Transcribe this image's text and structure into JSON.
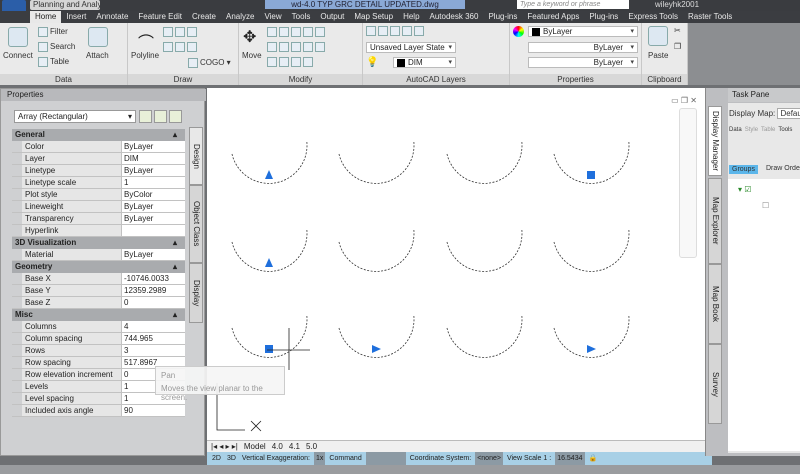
{
  "titlebar": {
    "app_badge": "MAP",
    "quick_access": "Planning and Analysis...",
    "document_title": "wd-4.0 TYP GRC DETAIL UPDATED.dwg",
    "search_placeholder": "Type a keyword or phrase",
    "user": "wileyhk2001"
  },
  "tabs": [
    "Home",
    "Insert",
    "Annotate",
    "Feature Edit",
    "Create",
    "Analyze",
    "View",
    "Tools",
    "Output",
    "Map Setup",
    "Help",
    "Autodesk 360",
    "Plug-ins",
    "Featured Apps",
    "Plug-ins",
    "Express Tools",
    "Raster Tools"
  ],
  "ribbon": {
    "data": {
      "label": "Data",
      "connect": "Connect",
      "filter": "Filter",
      "search": "Search",
      "table": "Table",
      "attach": "Attach"
    },
    "draw": {
      "label": "Draw",
      "polyline": "Polyline",
      "cogo": "COGO"
    },
    "modify": {
      "label": "Modify",
      "move": "Move"
    },
    "layers": {
      "label": "AutoCAD Layers",
      "layer_state": "Unsaved Layer State",
      "layer": "DIM"
    },
    "properties": {
      "label": "Properties",
      "color": "ByLayer",
      "linetype": "ByLayer",
      "lineweight": "ByLayer"
    },
    "clipboard": {
      "label": "Clipboard",
      "paste": "Paste"
    }
  },
  "properties_panel": {
    "title": "Properties",
    "selection": "Array (Rectangular)",
    "side_tabs": [
      "Design",
      "Object Class",
      "Display"
    ],
    "categories": [
      {
        "name": "General",
        "rows": [
          [
            "Color",
            "ByLayer"
          ],
          [
            "Layer",
            "DIM"
          ],
          [
            "Linetype",
            "ByLayer"
          ],
          [
            "Linetype scale",
            "1"
          ],
          [
            "Plot style",
            "ByColor"
          ],
          [
            "Lineweight",
            "ByLayer"
          ],
          [
            "Transparency",
            "ByLayer"
          ],
          [
            "Hyperlink",
            ""
          ]
        ]
      },
      {
        "name": "3D Visualization",
        "rows": [
          [
            "Material",
            "ByLayer"
          ]
        ]
      },
      {
        "name": "Geometry",
        "rows": [
          [
            "Base X",
            "-10746.0033"
          ],
          [
            "Base Y",
            "12359.2989"
          ],
          [
            "Base Z",
            "0"
          ]
        ]
      },
      {
        "name": "Misc",
        "rows": [
          [
            "Columns",
            "4"
          ],
          [
            "Column spacing",
            "744.965"
          ],
          [
            "Rows",
            "3"
          ],
          [
            "Row spacing",
            "517.8967"
          ],
          [
            "Row elevation increment",
            "0"
          ],
          [
            "Levels",
            "1"
          ],
          [
            "Level spacing",
            "1"
          ],
          [
            "Included axis angle",
            "90"
          ]
        ]
      }
    ]
  },
  "tooltip": {
    "title": "Pan",
    "description": "Moves the view planar to the screen."
  },
  "layout_tabs": [
    "Model",
    "4.0",
    "4.1",
    "5.0"
  ],
  "statusbar": {
    "btn_2d": "2D",
    "btn_3d": "3D",
    "vert_exag_label": "Vertical Exaggeration:",
    "vert_exag_value": "1x",
    "command": "Command",
    "coord_label": "Coordinate System:",
    "coord_value": "<none>",
    "view_scale_label": "View Scale 1 :",
    "view_scale_value": "16.5434"
  },
  "task_pane": {
    "title": "Task Pane",
    "display_map_label": "Display Map:",
    "display_map_value": "Default",
    "tools": [
      "Data",
      "Style",
      "Table",
      "Tools"
    ],
    "groups": "Groups",
    "draw_order": "Draw Order",
    "side_tabs": [
      "Display Manager",
      "Map Explorer",
      "Map Book",
      "Survey"
    ]
  },
  "colors": {
    "accent": "#1f6fdc",
    "ribbon_bg": "#eaeaea",
    "status_bg": "#a8d0e6"
  }
}
